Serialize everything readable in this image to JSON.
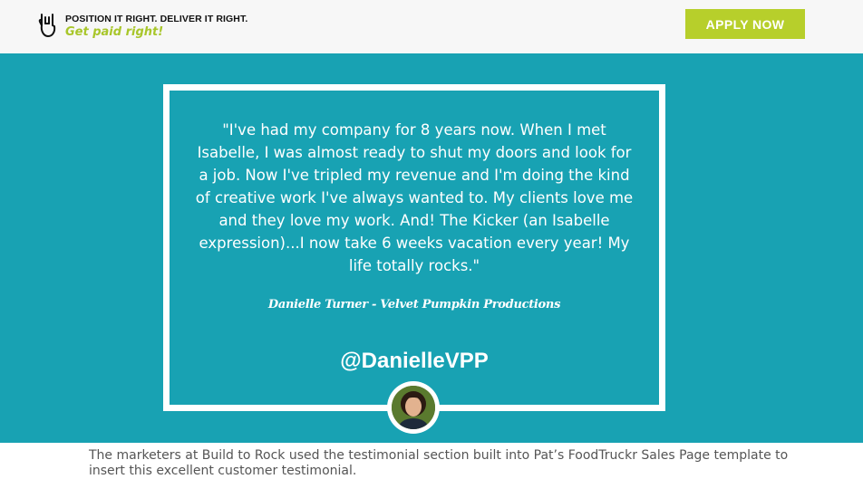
{
  "header": {
    "logo_line1": "POSITION IT RIGHT. DELIVER IT RIGHT.",
    "logo_line2": "Get paid right!",
    "logo_icon": "rock-hand-icon",
    "apply_label": "APPLY NOW"
  },
  "testimonial": {
    "quote": "\"I've had my company for 8 years now. When I met Isabelle, I was almost ready to shut my doors and look for a job. Now I've tripled my revenue and I'm doing the kind of creative work I've always wanted to. My clients love me and they love my work. And! The Kicker (an Isabelle expression)...I now take 6 weeks vacation every year! My life totally rocks.\"",
    "author": "Danielle Turner - Velvet Pumpkin Productions",
    "handle": "@DanielleVPP"
  },
  "caption": "The marketers at Build to Rock used the testimonial section built into Pat’s FoodTruckr Sales Page template to insert this excellent customer testimonial.",
  "colors": {
    "accent_green": "#b7cf2b",
    "hero_teal": "#18a2b3",
    "header_bg": "#f7f7f7"
  }
}
